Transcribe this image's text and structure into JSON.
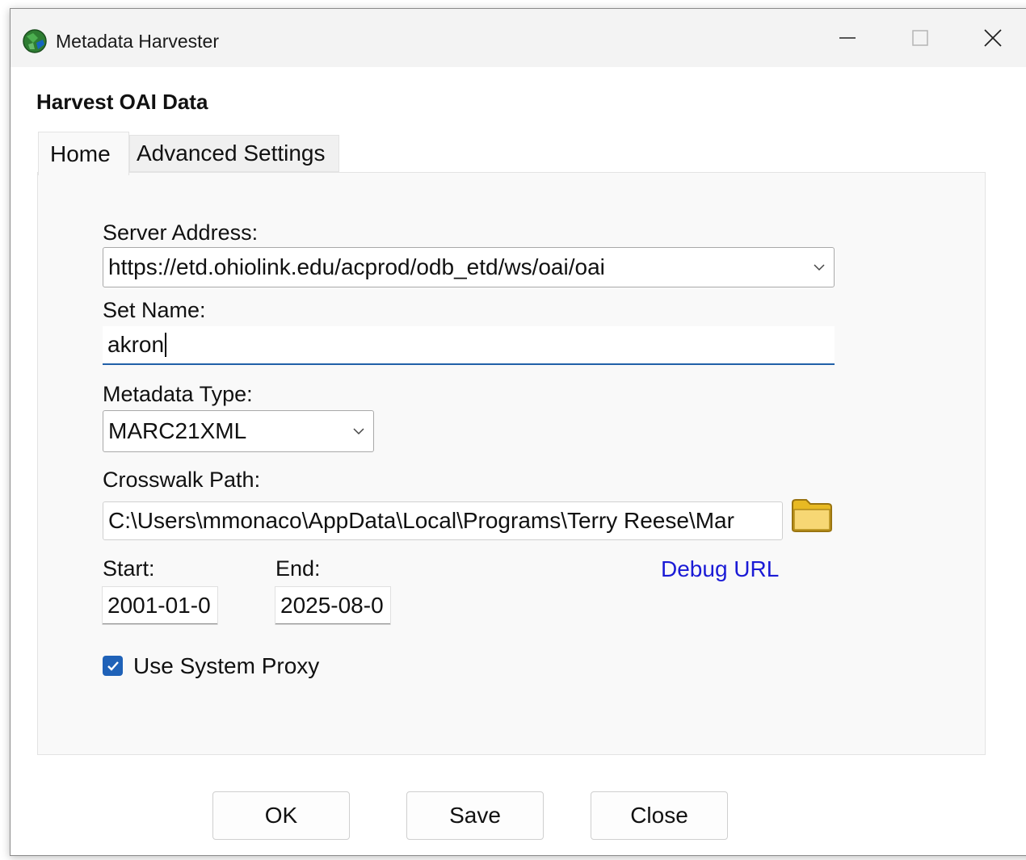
{
  "window": {
    "title": "Metadata Harvester",
    "icon": "globe-app-icon"
  },
  "dialog": {
    "heading": "Harvest OAI Data"
  },
  "tabs": [
    {
      "label": "Home",
      "selected": true
    },
    {
      "label": "Advanced Settings",
      "selected": false
    }
  ],
  "form": {
    "server_address_label": "Server Address:",
    "server_address_value": "https://etd.ohiolink.edu/acprod/odb_etd/ws/oai/oai",
    "set_name_label": "Set Name:",
    "set_name_value": "akron",
    "metadata_type_label": "Metadata Type:",
    "metadata_type_value": "MARC21XML",
    "crosswalk_path_label": "Crosswalk Path:",
    "crosswalk_path_value": "C:\\Users\\mmonaco\\AppData\\Local\\Programs\\Terry Reese\\Mar",
    "start_label": "Start:",
    "start_value": "2001-01-0",
    "end_label": "End:",
    "end_value": "2025-08-0",
    "debug_url_label": "Debug URL",
    "use_proxy_label": "Use System Proxy",
    "use_proxy_checked": true
  },
  "buttons": {
    "ok": "OK",
    "save": "Save",
    "close": "Close"
  },
  "colors": {
    "accent": "#1f62b8",
    "link": "#1b1bd6",
    "panel": "#f9f9f9"
  }
}
